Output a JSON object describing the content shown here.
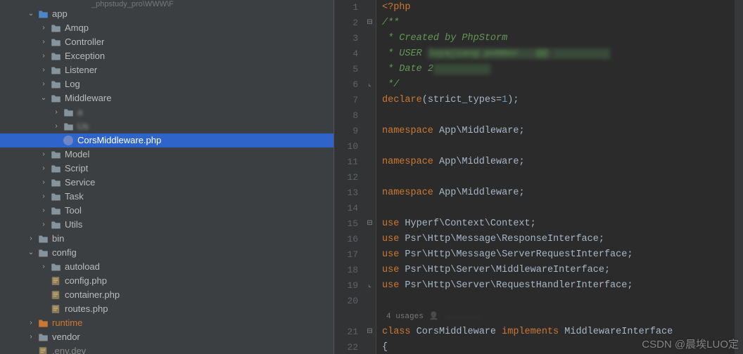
{
  "crumb": "_phpstudy_pro\\WWW\\F",
  "tree": [
    {
      "depth": 1,
      "arrow": "down",
      "icon": "folder-open",
      "label": "app",
      "cls": ""
    },
    {
      "depth": 2,
      "arrow": "right",
      "icon": "folder",
      "label": "Amqp",
      "cls": ""
    },
    {
      "depth": 2,
      "arrow": "right",
      "icon": "folder",
      "label": "Controller",
      "cls": ""
    },
    {
      "depth": 2,
      "arrow": "right",
      "icon": "folder",
      "label": "Exception",
      "cls": ""
    },
    {
      "depth": 2,
      "arrow": "right",
      "icon": "folder",
      "label": "Listener",
      "cls": ""
    },
    {
      "depth": 2,
      "arrow": "right",
      "icon": "folder",
      "label": "Log",
      "cls": ""
    },
    {
      "depth": 2,
      "arrow": "down",
      "icon": "folder",
      "label": "Middleware",
      "cls": ""
    },
    {
      "depth": 3,
      "arrow": "right",
      "icon": "folder",
      "label": "a",
      "cls": "blur"
    },
    {
      "depth": 3,
      "arrow": "right",
      "icon": "folder",
      "label": "Us",
      "cls": "blur"
    },
    {
      "depth": 3,
      "arrow": "none",
      "icon": "php",
      "label": "CorsMiddleware.php",
      "cls": "selected"
    },
    {
      "depth": 2,
      "arrow": "right",
      "icon": "folder",
      "label": "Model",
      "cls": ""
    },
    {
      "depth": 2,
      "arrow": "right",
      "icon": "folder",
      "label": "Script",
      "cls": ""
    },
    {
      "depth": 2,
      "arrow": "right",
      "icon": "folder",
      "label": "Service",
      "cls": ""
    },
    {
      "depth": 2,
      "arrow": "right",
      "icon": "folder",
      "label": "Task",
      "cls": ""
    },
    {
      "depth": 2,
      "arrow": "right",
      "icon": "folder",
      "label": "Tool",
      "cls": ""
    },
    {
      "depth": 2,
      "arrow": "right",
      "icon": "folder",
      "label": "Utils",
      "cls": ""
    },
    {
      "depth": 1,
      "arrow": "right",
      "icon": "folder",
      "label": "bin",
      "cls": ""
    },
    {
      "depth": 1,
      "arrow": "down",
      "icon": "folder",
      "label": "config",
      "cls": ""
    },
    {
      "depth": 2,
      "arrow": "right",
      "icon": "folder",
      "label": "autoload",
      "cls": ""
    },
    {
      "depth": 2,
      "arrow": "none",
      "icon": "conf",
      "label": "config.php",
      "cls": ""
    },
    {
      "depth": 2,
      "arrow": "none",
      "icon": "conf",
      "label": "container.php",
      "cls": ""
    },
    {
      "depth": 2,
      "arrow": "none",
      "icon": "conf",
      "label": "routes.php",
      "cls": ""
    },
    {
      "depth": 1,
      "arrow": "right",
      "icon": "folder-orange",
      "label": "runtime",
      "cls": "orange-label"
    },
    {
      "depth": 1,
      "arrow": "right",
      "icon": "folder",
      "label": "vendor",
      "cls": ""
    },
    {
      "depth": 1,
      "arrow": "none",
      "icon": "conf",
      "label": ".env.dev",
      "cls": "dim"
    }
  ],
  "gutter": [
    "1",
    "2",
    "3",
    "4",
    "5",
    "6",
    "7",
    "8",
    "9",
    "10",
    "11",
    "12",
    "13",
    "14",
    "15",
    "16",
    "17",
    "18",
    "19",
    "20",
    "",
    "21",
    "22"
  ],
  "fold": [
    "",
    "⊟",
    "",
    "",
    "",
    "⌞",
    "",
    "",
    "",
    "",
    "",
    "",
    "",
    "",
    "⊟",
    "",
    "",
    "",
    "⌞",
    "",
    "",
    "⊟",
    ""
  ],
  "code_lines": [
    {
      "segments": [
        {
          "t": "<?php",
          "c": "c-kw"
        }
      ]
    },
    {
      "segments": [
        {
          "t": "/**",
          "c": "c-comment"
        }
      ]
    },
    {
      "segments": [
        {
          "t": " * Created by PhpStorm",
          "c": "c-comment"
        }
      ]
    },
    {
      "segments": [
        {
          "t": " * USER ",
          "c": "c-comment"
        },
        {
          "t": "luyajiang pommor   QQ ",
          "c": "c-comment hl-comment blurred"
        },
        {
          "t": "          ",
          "c": "hl-comment blurred"
        }
      ]
    },
    {
      "segments": [
        {
          "t": " * Date ",
          "c": "c-comment"
        },
        {
          "t": "2",
          "c": "c-comment"
        },
        {
          "t": "          ",
          "c": "c-comment hl-comment blurred"
        }
      ]
    },
    {
      "segments": [
        {
          "t": " */",
          "c": "c-comment"
        }
      ]
    },
    {
      "segments": [
        {
          "t": "declare",
          "c": "c-kw"
        },
        {
          "t": "(",
          "c": "c-op"
        },
        {
          "t": "strict_types",
          "c": "c-ident"
        },
        {
          "t": "=",
          "c": "c-op"
        },
        {
          "t": "1",
          "c": "c-num"
        },
        {
          "t": ");",
          "c": "c-op"
        }
      ]
    },
    {
      "segments": [
        {
          "t": "",
          "c": ""
        }
      ]
    },
    {
      "segments": [
        {
          "t": "namespace ",
          "c": "c-kw"
        },
        {
          "t": "App\\Middleware",
          "c": "c-ident"
        },
        {
          "t": ";",
          "c": "c-op"
        }
      ]
    },
    {
      "segments": [
        {
          "t": "",
          "c": ""
        }
      ]
    },
    {
      "segments": [
        {
          "t": "namespace ",
          "c": "c-kw"
        },
        {
          "t": "App\\Middleware",
          "c": "c-ident"
        },
        {
          "t": ";",
          "c": "c-op"
        }
      ]
    },
    {
      "segments": [
        {
          "t": "",
          "c": ""
        }
      ]
    },
    {
      "segments": [
        {
          "t": "namespace ",
          "c": "c-kw"
        },
        {
          "t": "App\\Middleware",
          "c": "c-ident"
        },
        {
          "t": ";",
          "c": "c-op"
        }
      ]
    },
    {
      "segments": [
        {
          "t": "",
          "c": ""
        }
      ]
    },
    {
      "segments": [
        {
          "t": "use ",
          "c": "c-kw"
        },
        {
          "t": "Hyperf\\Context\\Context",
          "c": "c-ident"
        },
        {
          "t": ";",
          "c": "c-op"
        }
      ]
    },
    {
      "segments": [
        {
          "t": "use ",
          "c": "c-kw"
        },
        {
          "t": "Psr\\Http\\Message\\ResponseInterface",
          "c": "c-ident"
        },
        {
          "t": ";",
          "c": "c-op"
        }
      ]
    },
    {
      "segments": [
        {
          "t": "use ",
          "c": "c-kw"
        },
        {
          "t": "Psr\\Http\\Message\\ServerRequestInterface",
          "c": "c-ident"
        },
        {
          "t": ";",
          "c": "c-op"
        }
      ]
    },
    {
      "segments": [
        {
          "t": "use ",
          "c": "c-kw"
        },
        {
          "t": "Psr\\Http\\Server\\MiddlewareInterface",
          "c": "c-ident"
        },
        {
          "t": ";",
          "c": "c-op"
        }
      ]
    },
    {
      "segments": [
        {
          "t": "use ",
          "c": "c-kw"
        },
        {
          "t": "Psr\\Http\\Server\\RequestHandlerInterface",
          "c": "c-ident"
        },
        {
          "t": ";",
          "c": "c-op"
        }
      ]
    },
    {
      "segments": [
        {
          "t": "",
          "c": ""
        }
      ]
    }
  ],
  "usages_text": "4 usages",
  "code_tail": [
    {
      "segments": [
        {
          "t": "class ",
          "c": "c-kw"
        },
        {
          "t": "CorsMiddleware ",
          "c": "c-ident"
        },
        {
          "t": "implements ",
          "c": "c-kw"
        },
        {
          "t": "MiddlewareInterface",
          "c": "c-ident"
        }
      ]
    },
    {
      "segments": [
        {
          "t": "{",
          "c": "c-op"
        }
      ]
    }
  ],
  "watermark": "CSDN @晨埃LUO定",
  "colors": {
    "selection": "#2f65ca",
    "keyword": "#cc7832",
    "comment": "#629755"
  }
}
